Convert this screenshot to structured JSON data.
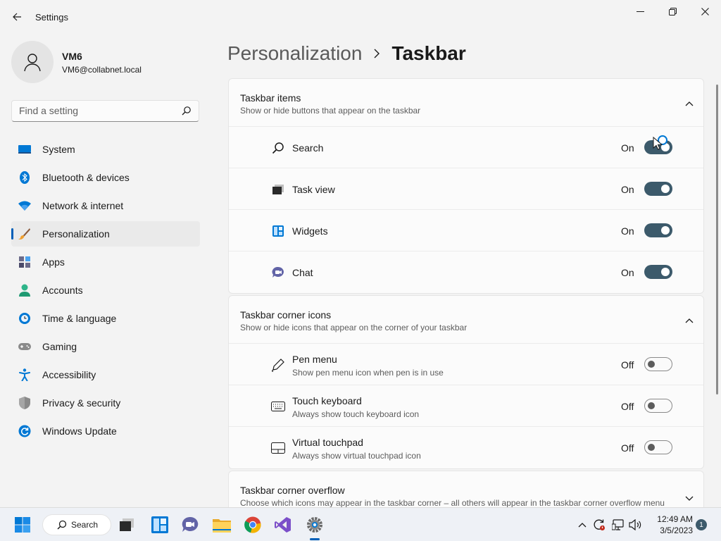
{
  "window": {
    "title": "Settings",
    "controls": [
      "minimize-icon",
      "maximize-icon",
      "close-icon"
    ]
  },
  "profile": {
    "name": "VM6",
    "email": "VM6@collabnet.local"
  },
  "search": {
    "placeholder": "Find a setting"
  },
  "sidebar": {
    "items": [
      {
        "label": "System",
        "icon": "monitor-icon"
      },
      {
        "label": "Bluetooth & devices",
        "icon": "bluetooth-icon"
      },
      {
        "label": "Network & internet",
        "icon": "wifi-icon"
      },
      {
        "label": "Personalization",
        "icon": "brush-icon",
        "active": true
      },
      {
        "label": "Apps",
        "icon": "apps-icon"
      },
      {
        "label": "Accounts",
        "icon": "person-icon"
      },
      {
        "label": "Time & language",
        "icon": "clock-globe-icon"
      },
      {
        "label": "Gaming",
        "icon": "gamepad-icon"
      },
      {
        "label": "Accessibility",
        "icon": "accessibility-icon"
      },
      {
        "label": "Privacy & security",
        "icon": "shield-icon"
      },
      {
        "label": "Windows Update",
        "icon": "update-icon"
      }
    ]
  },
  "breadcrumb": {
    "parent": "Personalization",
    "current": "Taskbar"
  },
  "sections": {
    "taskbar_items": {
      "title": "Taskbar items",
      "subtitle": "Show or hide buttons that appear on the taskbar",
      "rows": [
        {
          "label": "Search",
          "state": "On",
          "on": true,
          "icon": "search-icon"
        },
        {
          "label": "Task view",
          "state": "On",
          "on": true,
          "icon": "task-view-icon"
        },
        {
          "label": "Widgets",
          "state": "On",
          "on": true,
          "icon": "widgets-icon"
        },
        {
          "label": "Chat",
          "state": "On",
          "on": true,
          "icon": "chat-icon"
        }
      ]
    },
    "corner_icons": {
      "title": "Taskbar corner icons",
      "subtitle": "Show or hide icons that appear on the corner of your taskbar",
      "rows": [
        {
          "label": "Pen menu",
          "sub": "Show pen menu icon when pen is in use",
          "state": "Off",
          "on": false,
          "icon": "pen-icon"
        },
        {
          "label": "Touch keyboard",
          "sub": "Always show touch keyboard icon",
          "state": "Off",
          "on": false,
          "icon": "keyboard-icon"
        },
        {
          "label": "Virtual touchpad",
          "sub": "Always show virtual touchpad icon",
          "state": "Off",
          "on": false,
          "icon": "touchpad-icon"
        }
      ]
    },
    "corner_overflow": {
      "title": "Taskbar corner overflow",
      "subtitle": "Choose which icons may appear in the taskbar corner – all others will appear in the taskbar corner overflow menu"
    }
  },
  "taskbar": {
    "search_label": "Search",
    "clock_time": "12:49 AM",
    "clock_date": "3/5/2023",
    "notification_count": "1",
    "apps": [
      "start-icon",
      "task-view-icon",
      "widgets-icon",
      "chat-icon",
      "file-explorer-icon",
      "chrome-icon",
      "visual-studio-icon",
      "settings-icon"
    ]
  },
  "colors": {
    "accent": "#005fb8",
    "toggle_on": "#3c5a6b"
  }
}
